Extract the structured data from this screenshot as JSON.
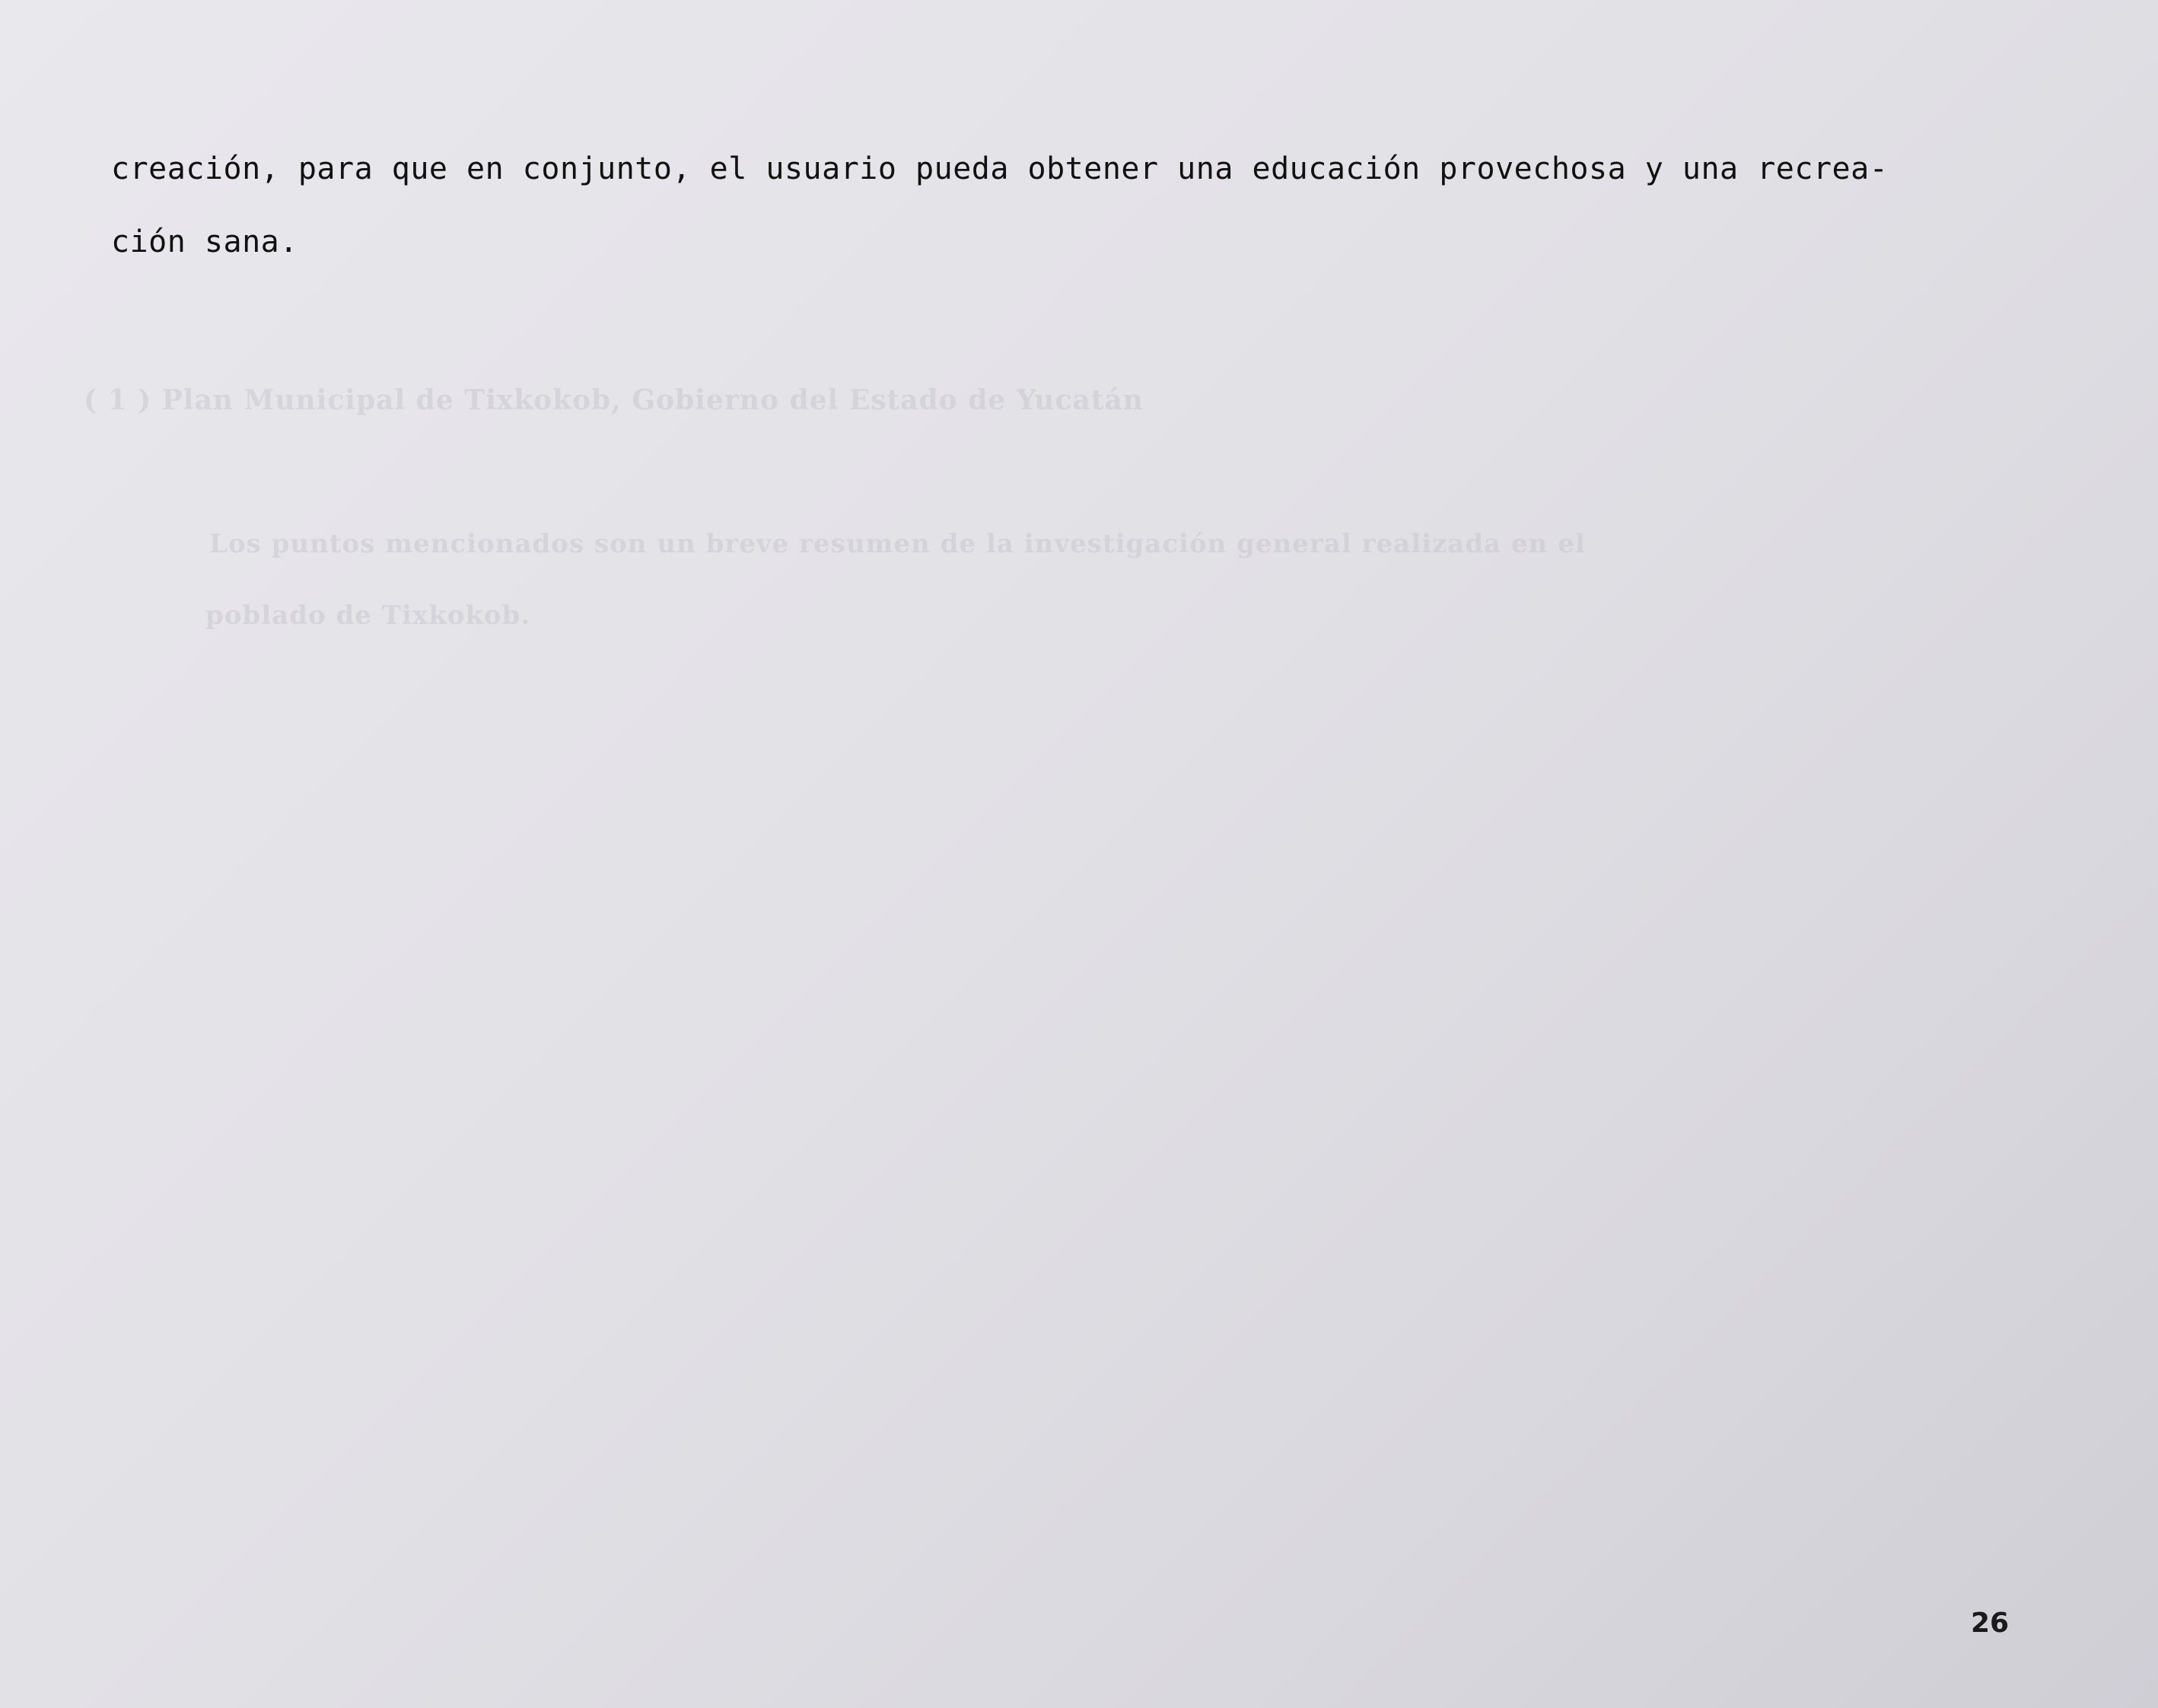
{
  "document": {
    "body_lines": [
      "creación, para que en conjunto, el usuario pueda obtener una educación provechosa y una recrea-",
      "ción sana."
    ],
    "show_through_lines": [
      "( 1 )  Plan Municipal de Tixkokob,   Gobierno del Estado de Yucatán",
      "Los puntos mencionados son un breve resumen de la investigación general realizada en el",
      "poblado de Tixkokob."
    ],
    "page_number": "26"
  }
}
